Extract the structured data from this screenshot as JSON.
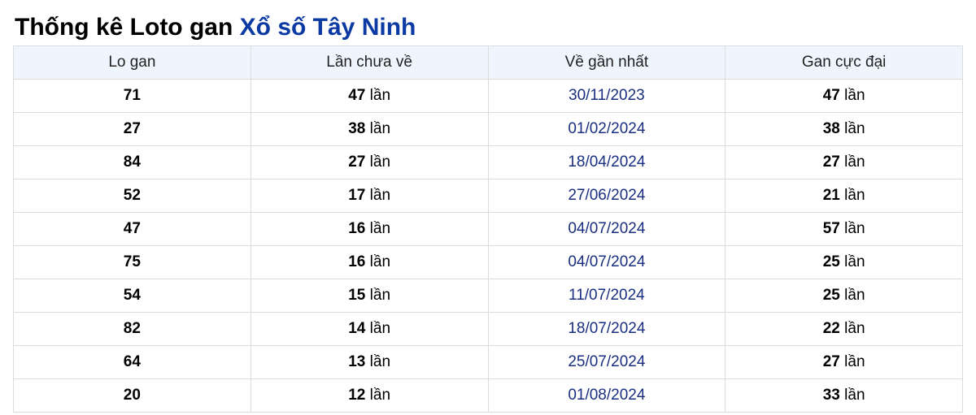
{
  "page": {
    "title_prefix": "Thống kê Loto gan",
    "title_accent": "Xổ số Tây Ninh"
  },
  "colors": {
    "accent": "#0b3aa3",
    "date_text": "#1a2f80",
    "header_bg": "#eef5fd",
    "border": "#dcdcdc"
  },
  "table": {
    "headers": [
      "Lo gan",
      "Lần chưa về",
      "Về gần nhất",
      "Gan cực đại"
    ],
    "rows": [
      {
        "lo": "71",
        "chua_ve": "47",
        "unit1": "lần",
        "ngay": "30/11/2023",
        "cuc_dai": "47",
        "unit2": "lần"
      },
      {
        "lo": "27",
        "chua_ve": "38",
        "unit1": "lần",
        "ngay": "01/02/2024",
        "cuc_dai": "38",
        "unit2": "lần"
      },
      {
        "lo": "84",
        "chua_ve": "27",
        "unit1": "lần",
        "ngay": "18/04/2024",
        "cuc_dai": "27",
        "unit2": "lần"
      },
      {
        "lo": "52",
        "chua_ve": "17",
        "unit1": "lần",
        "ngay": "27/06/2024",
        "cuc_dai": "21",
        "unit2": "lần"
      },
      {
        "lo": "47",
        "chua_ve": "16",
        "unit1": "lần",
        "ngay": "04/07/2024",
        "cuc_dai": "57",
        "unit2": "lần"
      },
      {
        "lo": "75",
        "chua_ve": "16",
        "unit1": "lần",
        "ngay": "04/07/2024",
        "cuc_dai": "25",
        "unit2": "lần"
      },
      {
        "lo": "54",
        "chua_ve": "15",
        "unit1": "lần",
        "ngay": "11/07/2024",
        "cuc_dai": "25",
        "unit2": "lần"
      },
      {
        "lo": "82",
        "chua_ve": "14",
        "unit1": "lần",
        "ngay": "18/07/2024",
        "cuc_dai": "22",
        "unit2": "lần"
      },
      {
        "lo": "64",
        "chua_ve": "13",
        "unit1": "lần",
        "ngay": "25/07/2024",
        "cuc_dai": "27",
        "unit2": "lần"
      },
      {
        "lo": "20",
        "chua_ve": "12",
        "unit1": "lần",
        "ngay": "01/08/2024",
        "cuc_dai": "33",
        "unit2": "lần"
      }
    ]
  }
}
